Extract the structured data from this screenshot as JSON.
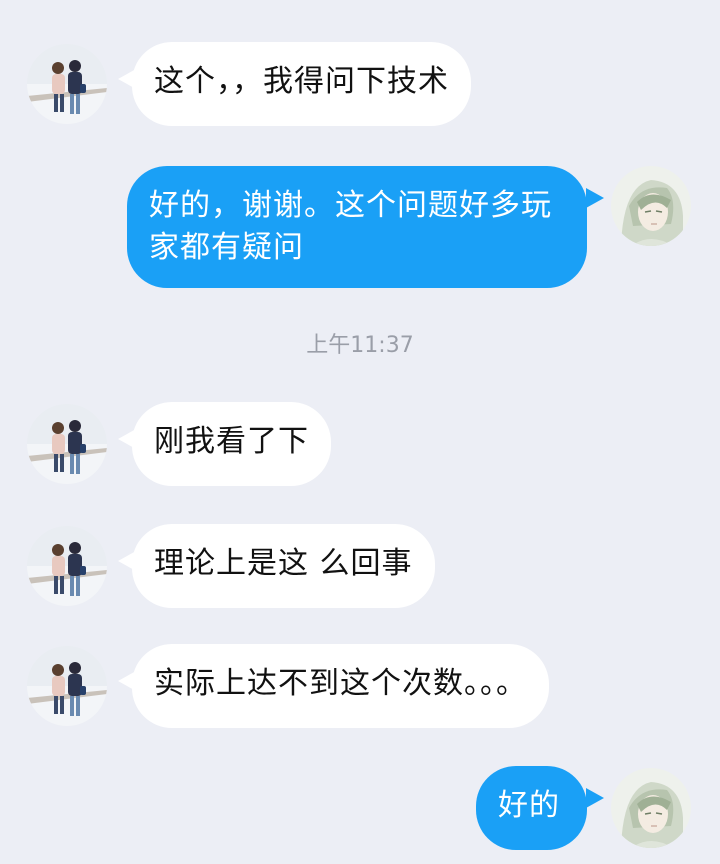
{
  "messages": [
    {
      "side": "in",
      "text": "这个，，我得问下技术"
    },
    {
      "side": "out",
      "text": "好的，谢谢。这个问题好多玩家都有疑问"
    },
    {
      "side": "in",
      "text": "刚我看了下"
    },
    {
      "side": "in",
      "text": "理论上是这 么回事"
    },
    {
      "side": "in",
      "text": "实际上达不到这个次数。。。"
    },
    {
      "side": "out",
      "text": "好的"
    }
  ],
  "timestamp": "上午11:37",
  "colors": {
    "background": "#eceef5",
    "incoming_bubble": "#ffffff",
    "outgoing_bubble": "#1aa0f6",
    "timestamp_text": "#9a9ea8"
  },
  "icons": {
    "contact_avatar": "couple-walking-avatar",
    "my_avatar": "anime-character-avatar"
  }
}
